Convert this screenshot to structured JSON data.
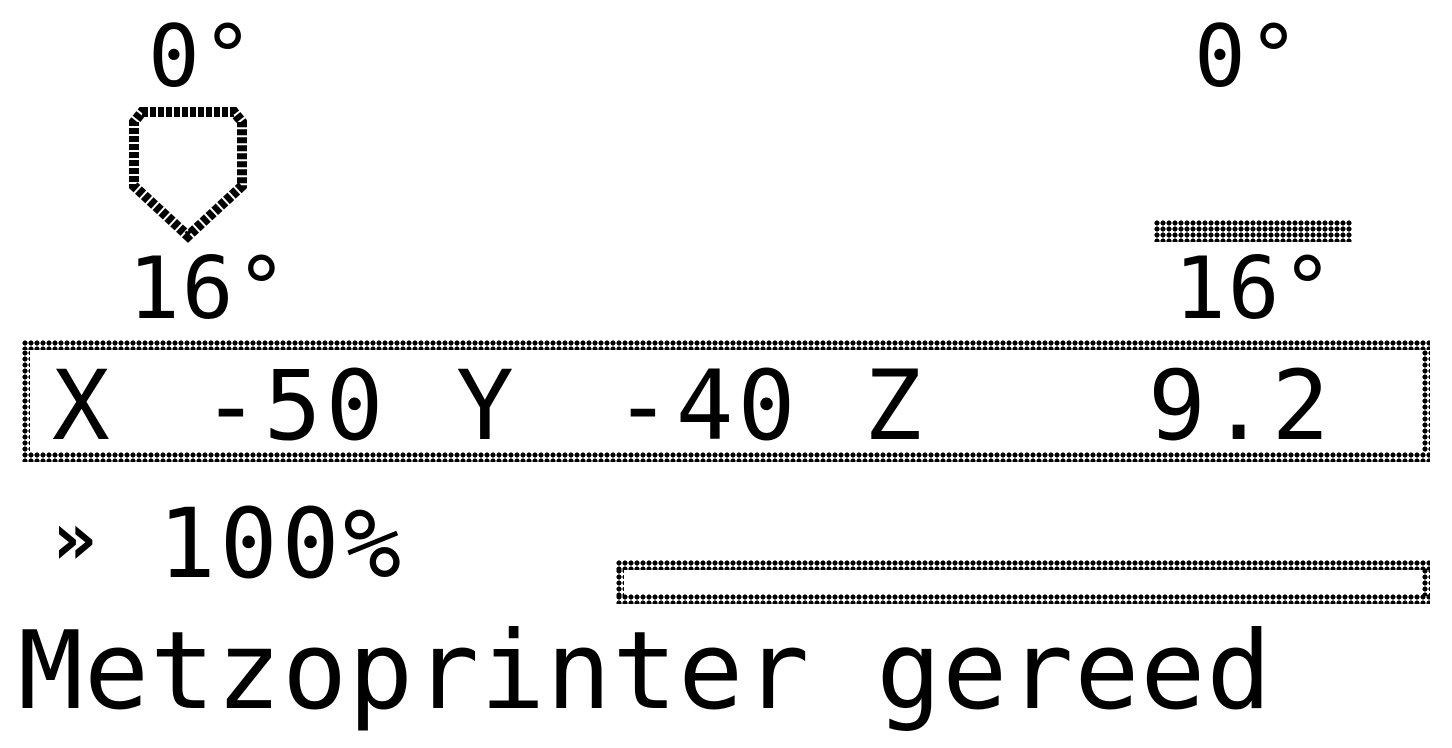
{
  "hotend": {
    "target_temp": "0°",
    "current_temp": "16°",
    "icon": "nozzle-icon"
  },
  "bed": {
    "target_temp": "0°",
    "current_temp": "16°",
    "icon": "heated-bed-icon"
  },
  "position": {
    "x_label": "X",
    "x_value": "-50",
    "y_label": "Y",
    "y_value": "-40",
    "z_label": "Z",
    "z_value": "9.2"
  },
  "feedrate": {
    "icon": "feedrate-arrow-icon",
    "value": "100%"
  },
  "progress": {
    "fraction": 0
  },
  "status_message": "Metzoprinter gereed",
  "colors": {
    "foreground": "#000000",
    "background": "#ffffff"
  }
}
